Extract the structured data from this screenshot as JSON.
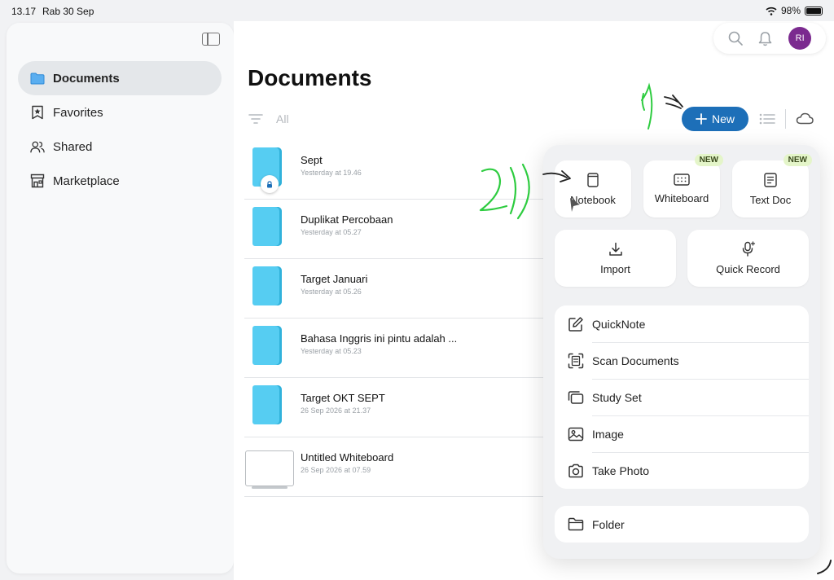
{
  "status_bar": {
    "time": "13.17",
    "date": "Rab 30 Sep",
    "battery_percent": "98%",
    "battery_level": 0.98
  },
  "sidebar": {
    "items": [
      {
        "label": "Documents",
        "icon": "folder-icon",
        "active": true
      },
      {
        "label": "Favorites",
        "icon": "star-bookmark-icon",
        "active": false
      },
      {
        "label": "Shared",
        "icon": "people-icon",
        "active": false
      },
      {
        "label": "Marketplace",
        "icon": "store-icon",
        "active": false
      }
    ]
  },
  "header": {
    "title": "Documents",
    "filter_label": "All",
    "avatar_initials": "RI",
    "new_button_label": "New"
  },
  "documents": [
    {
      "name": "Sept",
      "date": "Yesterday at 19.46",
      "type": "notebook",
      "locked": true
    },
    {
      "name": "Duplikat Percobaan",
      "date": "Yesterday at 05.27",
      "type": "notebook"
    },
    {
      "name": "Target Januari",
      "date": "Yesterday at 05.26",
      "type": "notebook"
    },
    {
      "name": "Bahasa Inggris ini pintu adalah ...",
      "date": "Yesterday at 05.23",
      "type": "notebook"
    },
    {
      "name": "Target OKT SEPT",
      "date": "26 Sep 2026 at 21.37",
      "type": "notebook"
    },
    {
      "name": "Untitled Whiteboard",
      "date": "26 Sep 2026 at 07.59",
      "type": "whiteboard"
    }
  ],
  "new_menu": {
    "tiles": [
      {
        "label": "Notebook",
        "icon": "notebook-icon",
        "badge": ""
      },
      {
        "label": "Whiteboard",
        "icon": "whiteboard-icon",
        "badge": "NEW"
      },
      {
        "label": "Text Doc",
        "icon": "text-doc-icon",
        "badge": "NEW"
      },
      {
        "label": "Import",
        "icon": "download-icon",
        "badge": ""
      },
      {
        "label": "Quick Record",
        "icon": "microphone-icon",
        "badge": ""
      }
    ],
    "list": [
      {
        "label": "QuickNote",
        "icon": "pencil-square-icon"
      },
      {
        "label": "Scan Documents",
        "icon": "scan-icon"
      },
      {
        "label": "Study Set",
        "icon": "cards-icon"
      },
      {
        "label": "Image",
        "icon": "image-icon"
      },
      {
        "label": "Take Photo",
        "icon": "camera-icon"
      }
    ],
    "folder_label": "Folder"
  },
  "annotations": {
    "step1": "1)",
    "step2": "2)"
  },
  "colors": {
    "accent": "#1d6fb8",
    "notebook": "#56cdf2",
    "avatar": "#7b2a8f",
    "annotation": "#2ecc40",
    "new_badge": "#e4f5c9"
  }
}
